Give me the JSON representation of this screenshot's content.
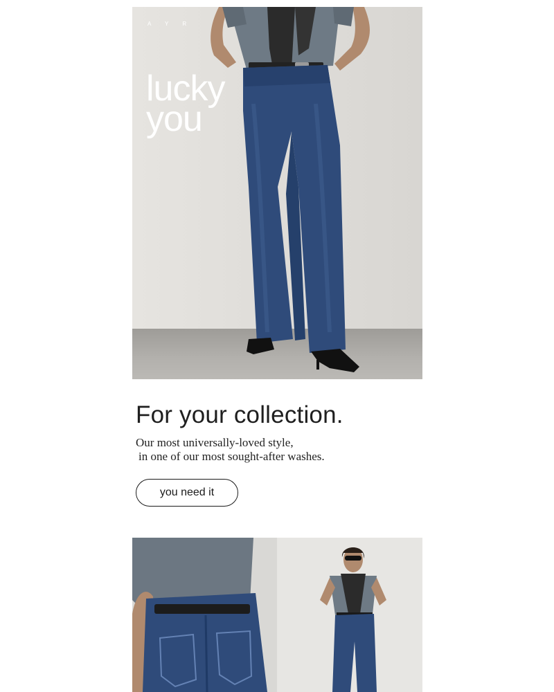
{
  "brand": {
    "logo_text": "A Y R"
  },
  "hero": {
    "headline_line1": "lucky",
    "headline_line2": "you",
    "image_alt": "model wearing wide-leg dark wash jeans"
  },
  "copy": {
    "title": "For your collection.",
    "body_line1": "Our most universally-loved style,",
    "body_line2": "in one of our most sought-after washes."
  },
  "cta": {
    "label": "you need it"
  },
  "gallery": {
    "left_alt": "close-up of jeans back pockets",
    "right_alt": "full-length model in jeans and sunglasses"
  },
  "colors": {
    "denim": "#2e4a78",
    "tee": "#6c7883",
    "wall": "#e3e1dd",
    "sweater": "#2a2a2a"
  }
}
